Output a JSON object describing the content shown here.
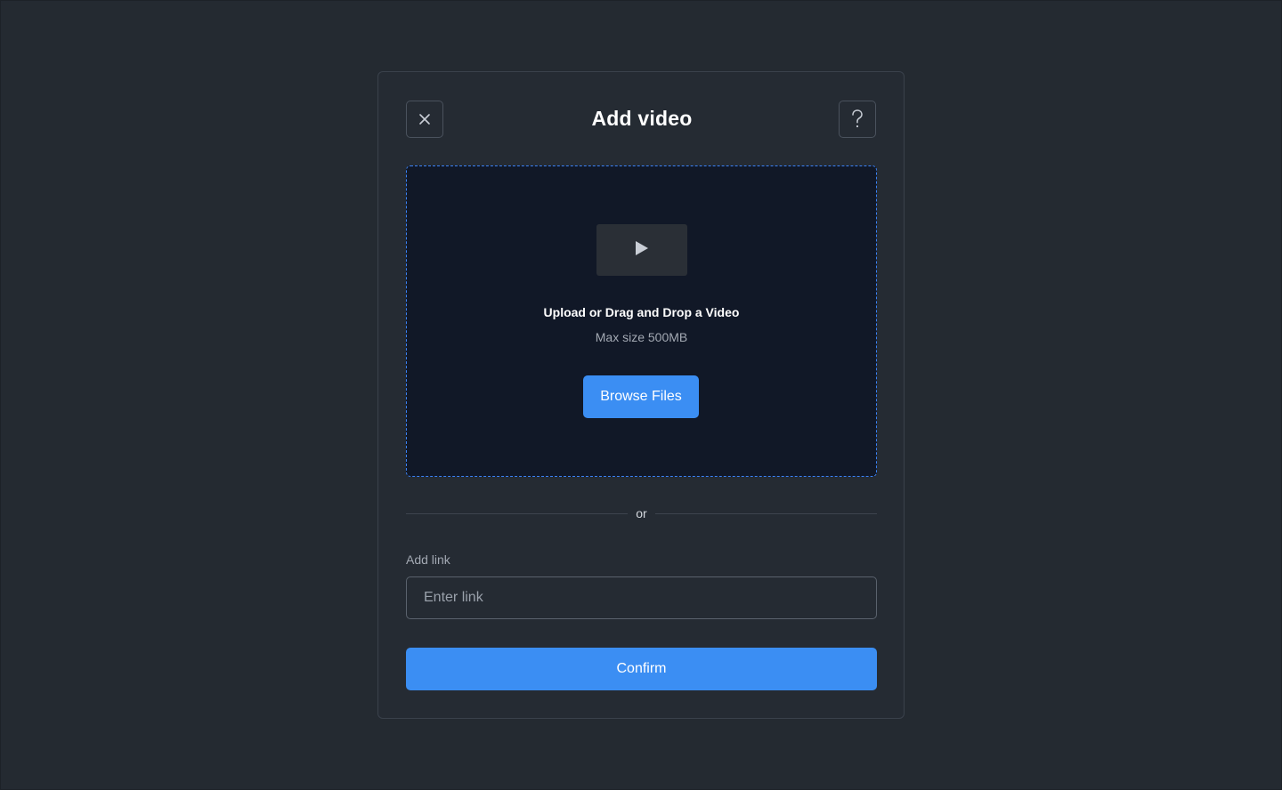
{
  "modal": {
    "title": "Add video",
    "close_icon": "close-icon",
    "help_icon": "question-mark-icon"
  },
  "dropzone": {
    "icon": "play-icon",
    "title": "Upload or Drag and Drop a Video",
    "subtitle": "Max size 500MB",
    "browse_label": "Browse Files"
  },
  "divider": {
    "text": "or"
  },
  "link": {
    "label": "Add link",
    "placeholder": "Enter link",
    "value": ""
  },
  "confirm_label": "Confirm",
  "colors": {
    "background": "#242a31",
    "modal": "#252b33",
    "dropzone": "#111827",
    "accent": "#3b8ef3",
    "dashed_border": "#3b82f6"
  }
}
